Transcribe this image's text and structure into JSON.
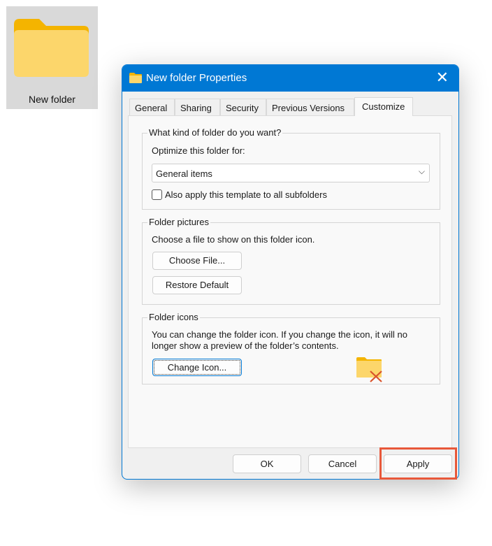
{
  "desktop": {
    "icon_label": "New folder"
  },
  "dialog": {
    "title": "New folder Properties",
    "close": "✕",
    "tabs": [
      "General",
      "Sharing",
      "Security",
      "Previous Versions",
      "Customize"
    ],
    "active_tab": "Customize",
    "group_kind": {
      "legend": "What kind of folder do you want?",
      "optimize_label": "Optimize this folder for:",
      "optimize_value": "General items",
      "checkbox_label": "Also apply this template to all subfolders",
      "checkbox_checked": false
    },
    "group_pictures": {
      "legend": "Folder pictures",
      "description": "Choose a file to show on this folder icon.",
      "choose_file": "Choose File...",
      "restore_default": "Restore Default"
    },
    "group_icons": {
      "legend": "Folder icons",
      "description": "You can change the folder icon. If you change the icon, it will no longer show a preview of the folder’s contents.",
      "change_icon": "Change Icon..."
    },
    "buttons": {
      "ok": "OK",
      "cancel": "Cancel",
      "apply": "Apply"
    },
    "colors": {
      "accent": "#0078d4",
      "highlight": "#e8583a"
    }
  }
}
